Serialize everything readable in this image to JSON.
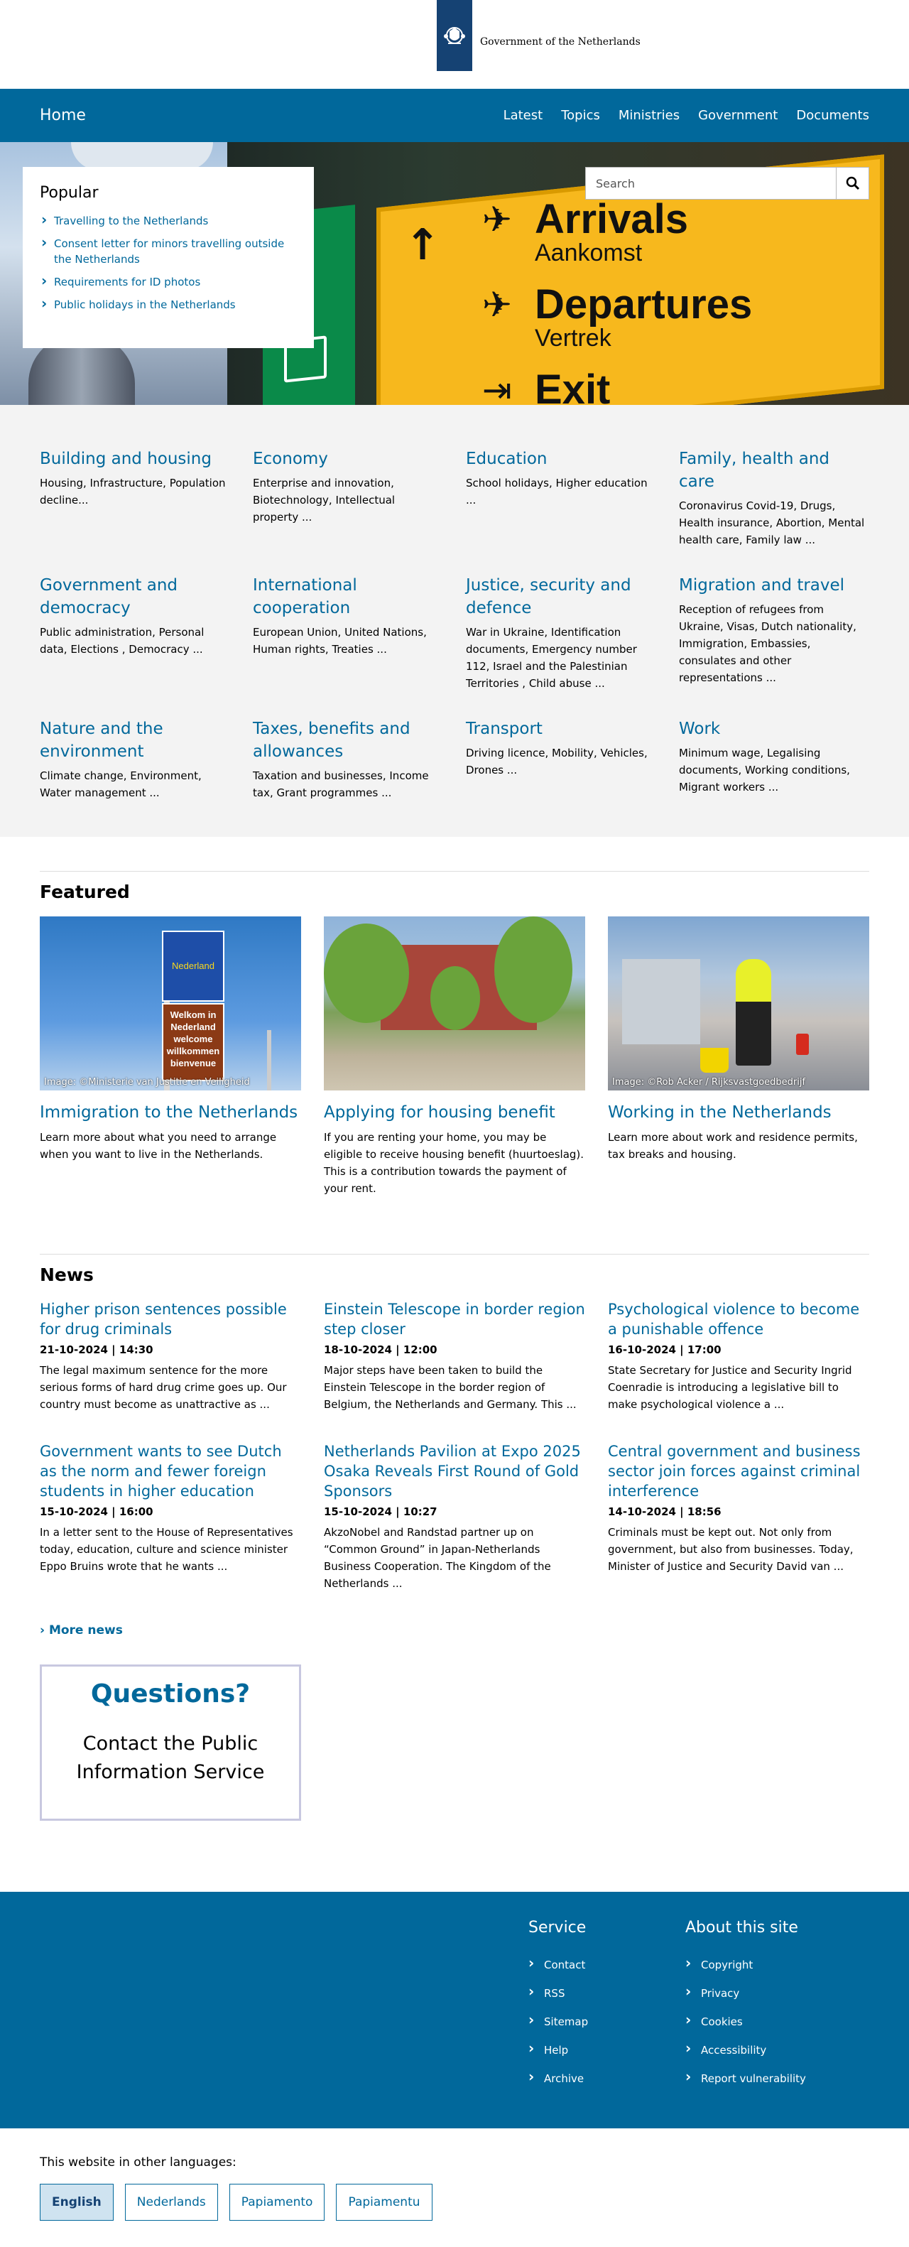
{
  "header": {
    "logo_text": "Government of the Netherlands"
  },
  "nav": {
    "home": "Home",
    "items": [
      "Latest",
      "Topics",
      "Ministries",
      "Government",
      "Documents"
    ]
  },
  "hero": {
    "popular_title": "Popular",
    "popular_links": [
      "Travelling to the Netherlands",
      "Consent letter for minors travelling outside the Netherlands",
      "Requirements for ID photos",
      "Public holidays in the Netherlands"
    ],
    "search_placeholder": "Search",
    "sign_arrivals": "Arrivals",
    "sign_aankomst": "Aankomst",
    "sign_departures": "Departures",
    "sign_vertrek": "Vertrek",
    "sign_exit": "Exit"
  },
  "topics": [
    {
      "title": "Building and housing",
      "desc": "Housing, Infrastructure, Population decline..."
    },
    {
      "title": "Economy",
      "desc": "Enterprise and innovation, Biotechnology, Intellectual property ..."
    },
    {
      "title": "Education",
      "desc": "School holidays, Higher education ..."
    },
    {
      "title": "Family, health and care",
      "desc": "Coronavirus Covid-19, Drugs, Health insurance, Abortion, Mental health care, Family law ..."
    },
    {
      "title": "Government and democracy",
      "desc": "Public administration, Personal data, Elections , Democracy ..."
    },
    {
      "title": "International cooperation",
      "desc": "European Union, United Nations, Human rights, Treaties ..."
    },
    {
      "title": "Justice, security and defence",
      "desc": "War in Ukraine, Identification documents, Emergency number 112, Israel and the Palestinian Territories , Child abuse ..."
    },
    {
      "title": "Migration and travel",
      "desc": "Reception of refugees from Ukraine, Visas, Dutch nationality, Immigration, Embassies, consulates and other representations ..."
    },
    {
      "title": "Nature and the environment",
      "desc": "Climate change, Environment, Water management ..."
    },
    {
      "title": "Taxes, benefits and allowances",
      "desc": "Taxation and businesses, Income tax, Grant programmes ..."
    },
    {
      "title": "Transport",
      "desc": "Driving licence, Mobility, Vehicles, Drones ..."
    },
    {
      "title": "Work",
      "desc": "Minimum wage, Legalising documents, Working conditions, Migrant workers ..."
    }
  ],
  "featured": {
    "heading": "Featured",
    "items": [
      {
        "title": "Immigration to the Netherlands",
        "desc": "Learn more about what you need to arrange when you want to live in the Netherlands.",
        "caption": "Image: ©Ministerie van Justitie en Veiligheid",
        "sign1": "Nederland",
        "sign2": "Welkom in Nederland welcome willkommen bienvenue"
      },
      {
        "title": "Applying for housing benefit",
        "desc": "If you are renting your home, you may be eligible to receive housing benefit (huurtoeslag). This is a contribution towards the payment of your rent.",
        "caption": ""
      },
      {
        "title": "Working in the Netherlands",
        "desc": "Learn more about work and residence permits, tax breaks and housing.",
        "caption": "Image: ©Rob Acker / Rijksvastgoedbedrijf"
      }
    ]
  },
  "news": {
    "heading": "News",
    "items": [
      {
        "title": "Higher prison sentences possible for drug criminals",
        "date": "21-10-2024 | 14:30",
        "desc": "The legal maximum sentence for the more serious forms of hard drug crime goes up. Our country must become as unattractive as ..."
      },
      {
        "title": "Einstein Telescope in border region step closer",
        "date": "18-10-2024 | 12:00",
        "desc": "Major steps have been taken to build the Einstein Telescope in the border region of Belgium, the Netherlands and Germany. This ..."
      },
      {
        "title": "Psychological violence to become a punishable offence",
        "date": "16-10-2024 | 17:00",
        "desc": "State Secretary for Justice and Security Ingrid Coenradie is introducing a legislative bill to make psychological violence a ..."
      },
      {
        "title": "Government wants to see Dutch as the norm and fewer foreign students in higher education",
        "date": "15-10-2024 | 16:00",
        "desc": "In a letter sent to the House of Representatives today, education, culture and science minister Eppo Bruins wrote that he wants ..."
      },
      {
        "title": "Netherlands Pavilion at Expo 2025 Osaka Reveals First Round of Gold Sponsors",
        "date": "15-10-2024 | 10:27",
        "desc": "AkzoNobel and Randstad partner up on “Common Ground” in Japan-Netherlands Business Cooperation. The Kingdom of the Netherlands ..."
      },
      {
        "title": "Central government and business sector join forces against criminal interference",
        "date": "14-10-2024 | 18:56",
        "desc": "Criminals must be kept out. Not only from government, but also from businesses. Today, Minister of Justice and Security David van ..."
      }
    ],
    "more": "More news"
  },
  "questions": {
    "title": "Questions?",
    "text": "Contact the Public Information Service"
  },
  "footer": {
    "service_title": "Service",
    "service_links": [
      "Contact",
      "RSS",
      "Sitemap",
      "Help",
      "Archive"
    ],
    "about_title": "About this site",
    "about_links": [
      "Copyright",
      "Privacy",
      "Cookies",
      "Accessibility",
      "Report vulnerability"
    ]
  },
  "languages": {
    "label": "This website in other languages:",
    "items": [
      "English",
      "Nederlands",
      "Papiamento",
      "Papiamentu"
    ],
    "active": "English"
  },
  "colors": {
    "brand_blue": "#01689b",
    "logo_blue": "#154273",
    "topic_bg": "#f3f3f3"
  }
}
